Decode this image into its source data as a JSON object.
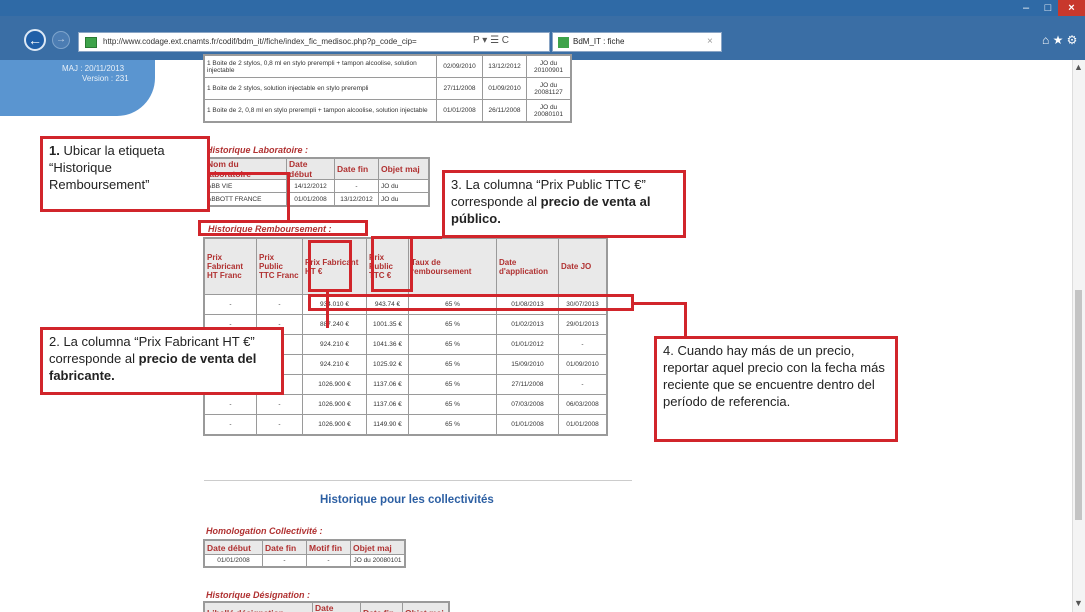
{
  "browser": {
    "url": "http://www.codage.ext.cnamts.fr/codif/bdm_it//fiche/index_fic_medisoc.php?p_code_cip=",
    "address_tools": "Ρ ▾ ☰ C",
    "tab_title": "BdM_IT : fiche",
    "tab_close": "×",
    "window_min": "–",
    "window_max": "□",
    "window_close": "×",
    "back": "←",
    "forward": "→",
    "toolbar_icons": "⌂ ★ ⚙"
  },
  "sidebar": {
    "maj": "MAJ : 20/11/2013",
    "version": "Version : 231"
  },
  "top_table": {
    "rows": [
      [
        "1 Boite de 2 stylos, 0,8 ml en stylo prerempli + tampon alcoolise, solution injectable",
        "02/09/2010",
        "13/12/2012",
        "JO du 20100901"
      ],
      [
        "1 Boite de 2 stylos, solution injectable en stylo prerempli",
        "27/11/2008",
        "01/09/2010",
        "JO du 20081127"
      ],
      [
        "1 Boite de 2, 0,8 ml en stylo prerempli + tampon alcoolise, solution injectable",
        "01/01/2008",
        "26/11/2008",
        "JO du 20080101"
      ]
    ]
  },
  "labo": {
    "title": "Historique Laboratoire :",
    "headers": [
      "Nom du laboratoire",
      "Date début",
      "Date fin",
      "Objet maj"
    ],
    "rows": [
      [
        "ABB VIE",
        "14/12/2012",
        "-",
        "JO du"
      ],
      [
        "ABBOTT FRANCE",
        "01/01/2008",
        "13/12/2012",
        "JO du"
      ]
    ]
  },
  "rembourse": {
    "title": "Historique Remboursement :",
    "headers": [
      "Prix Fabricant HT Franc",
      "Prix Public TTC Franc",
      "Prix Fabricant HT €",
      "Prix Public TTC €",
      "Taux de remboursement",
      "Date d'application",
      "Date JO"
    ],
    "rows": [
      [
        "-",
        "-",
        "934.010 €",
        "943.74 €",
        "65 %",
        "01/08/2013",
        "30/07/2013"
      ],
      [
        "-",
        "-",
        "887.240 €",
        "1001.35 €",
        "65 %",
        "01/02/2013",
        "29/01/2013"
      ],
      [
        "-",
        "-",
        "924.210 €",
        "1041.36 €",
        "65 %",
        "01/01/2012",
        "-"
      ],
      [
        "-",
        "-",
        "924.210 €",
        "1025.92 €",
        "65 %",
        "15/09/2010",
        "01/09/2010"
      ],
      [
        "-",
        "-",
        "1026.900 €",
        "1137.06 €",
        "65 %",
        "27/11/2008",
        "-"
      ],
      [
        "-",
        "-",
        "1026.900 €",
        "1137.06 €",
        "65 %",
        "07/03/2008",
        "06/03/2008"
      ],
      [
        "-",
        "-",
        "1026.900 €",
        "1149.90 €",
        "65 %",
        "01/01/2008",
        "01/01/2008"
      ]
    ]
  },
  "collectivites_title": "Historique pour les collectivités",
  "homologation": {
    "title": "Homologation Collectivité :",
    "headers": [
      "Date début",
      "Date fin",
      "Motif fin",
      "Objet maj"
    ],
    "row": [
      "01/01/2008",
      "-",
      "-",
      "JO du 20080101"
    ]
  },
  "designation": {
    "title": "Historique Désignation :",
    "headers": [
      "Libellé désignation",
      "Date début",
      "Date fin",
      "Objet maj"
    ]
  },
  "notes": {
    "n1": {
      "num": "1.",
      "text": " Ubicar la etiqueta “Historique Remboursement”"
    },
    "n2": {
      "a": "2. La columna “Prix Fabricant HT €” corresponde al ",
      "b": "precio de venta del fabricante."
    },
    "n3": {
      "a": "3. La columna “Prix Public TTC €” corresponde al ",
      "b": "precio de venta al público."
    },
    "n4": {
      "text": "4. Cuando hay más de un precio, reportar aquel precio con la fecha más reciente que se encuentre dentro del período de referencia."
    }
  },
  "colors": {
    "annotation_red": "#d1252b",
    "header_red": "#b03131",
    "link_blue": "#2c5fa3",
    "chrome_blue": "#3a6ea5"
  }
}
